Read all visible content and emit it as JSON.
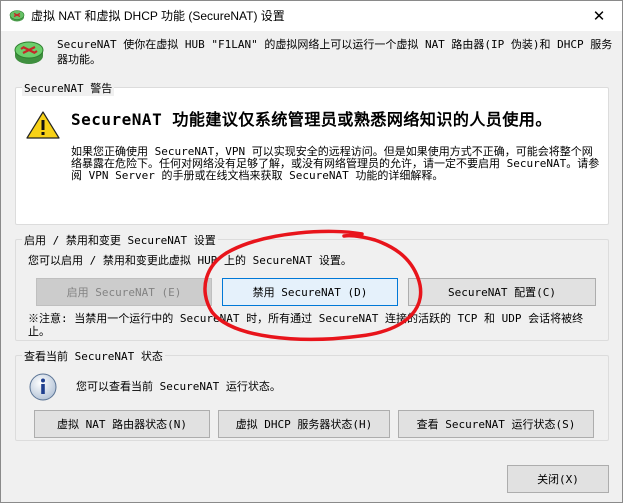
{
  "window": {
    "title": "虚拟 NAT 和虚拟 DHCP 功能 (SecureNAT) 设置",
    "close_glyph": "✕"
  },
  "header": {
    "description": "SecureNAT 使你在虚拟 HUB \"F1LAN\" 的虚拟网络上可以运行一个虚拟 NAT 路由器(IP 伪装)和 DHCP 服务器功能。"
  },
  "warning": {
    "legend": "SecureNAT 警告",
    "heading": "SecureNAT 功能建议仅系统管理员或熟悉网络知识的人员使用。",
    "body": "如果您正确使用 SecureNAT，VPN 可以实现安全的远程访问。但是如果使用方式不正确，可能会将整个网络暴露在危险下。任何对网络没有足够了解，或没有网络管理员的允许，请一定不要启用 SecureNAT。请参阅 VPN Server 的手册或在线文档来获取 SecureNAT 功能的详细解释。"
  },
  "enable": {
    "legend": "启用 / 禁用和变更 SecureNAT 设置",
    "description": "您可以启用 / 禁用和变更此虚拟 HUB 上的 SecureNAT 设置。",
    "enable_button": "启用 SecureNAT (E)",
    "disable_button": "禁用 SecureNAT (D)",
    "config_button": "SecureNAT 配置(C)",
    "note": "※注意: 当禁用一个运行中的 SecureNAT 时，所有通过 SecureNAT 连接的活跃的 TCP 和 UDP 会话将被终止。"
  },
  "status": {
    "legend": "查看当前 SecureNAT 状态",
    "description": "您可以查看当前 SecureNAT 运行状态。",
    "nat_button": "虚拟 NAT 路由器状态(N)",
    "dhcp_button": "虚拟 DHCP 服务器状态(H)",
    "view_button": "查看 SecureNAT 运行状态(S)"
  },
  "footer": {
    "close_button": "关闭(X)"
  },
  "colors": {
    "window_bg": "#f0f0f0",
    "focus_border": "#0078d7",
    "annotation_red": "#e8141b",
    "warning_yellow": "#f7d117"
  }
}
